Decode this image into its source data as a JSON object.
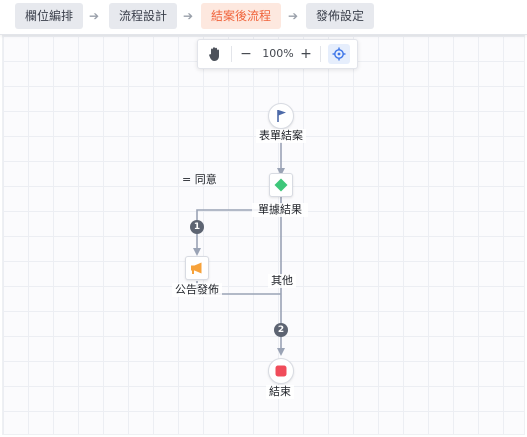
{
  "steps": [
    {
      "label": "欄位編排"
    },
    {
      "label": "流程設計"
    },
    {
      "label": "結案後流程"
    },
    {
      "label": "發佈設定"
    }
  ],
  "zoom": {
    "level": "100%",
    "minus": "−",
    "plus": "+"
  },
  "flow": {
    "start_label": "表單結案",
    "gateway_label": "單據結果",
    "branch1_condition": "= 同意",
    "branch1_index": "1",
    "notice_label": "公告發佈",
    "branch2_condition": "其他",
    "branch2_index": "2",
    "end_label": "結束"
  },
  "colors": {
    "active_step": "#f0633b",
    "gateway": "#3ec77a",
    "end": "#f04c5a",
    "notice": "#f7a23a",
    "edge": "#9aa3b5"
  }
}
